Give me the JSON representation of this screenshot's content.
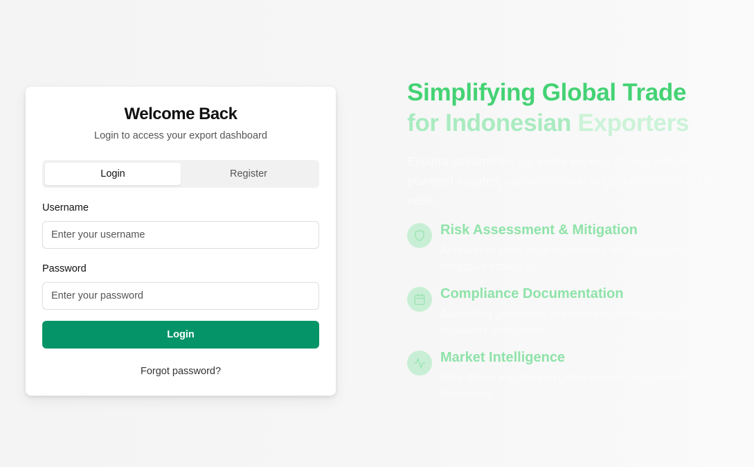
{
  "card": {
    "title": "Welcome Back",
    "subtitle": "Login to access your export dashboard",
    "tabs": [
      {
        "label": "Login",
        "active": true
      },
      {
        "label": "Register",
        "active": false
      }
    ],
    "username": {
      "label": "Username",
      "placeholder": "Enter your username",
      "value": ""
    },
    "password": {
      "label": "Password",
      "placeholder": "Enter your password",
      "value": ""
    },
    "login_button": "Login",
    "forgot_link": "Forgot password?"
  },
  "hero": {
    "title_line1": "Simplifying Global Trade",
    "title_line2_a": "for Indonesian ",
    "title_line2_b": "Exporters",
    "description": "Exvorta streamlines the entire export process with AI-powered insights, connecting you to global markets with ease.",
    "features": [
      {
        "icon": "shield-icon",
        "title": "Risk Assessment & Mitigation",
        "description": "AI-powered analysis of export risks with actionable mitigation strategies"
      },
      {
        "icon": "calendar-icon",
        "title": "Compliance Documentation",
        "description": "Automated generation of export documentation with regulatory compliance"
      },
      {
        "icon": "activity-icon",
        "title": "Market Intelligence",
        "description": "Data-driven insights into global markets and demand forecasting"
      }
    ]
  },
  "colors": {
    "primary": "#059467",
    "accent_green": "#44d274",
    "icon_bg": "#c8efd5"
  }
}
